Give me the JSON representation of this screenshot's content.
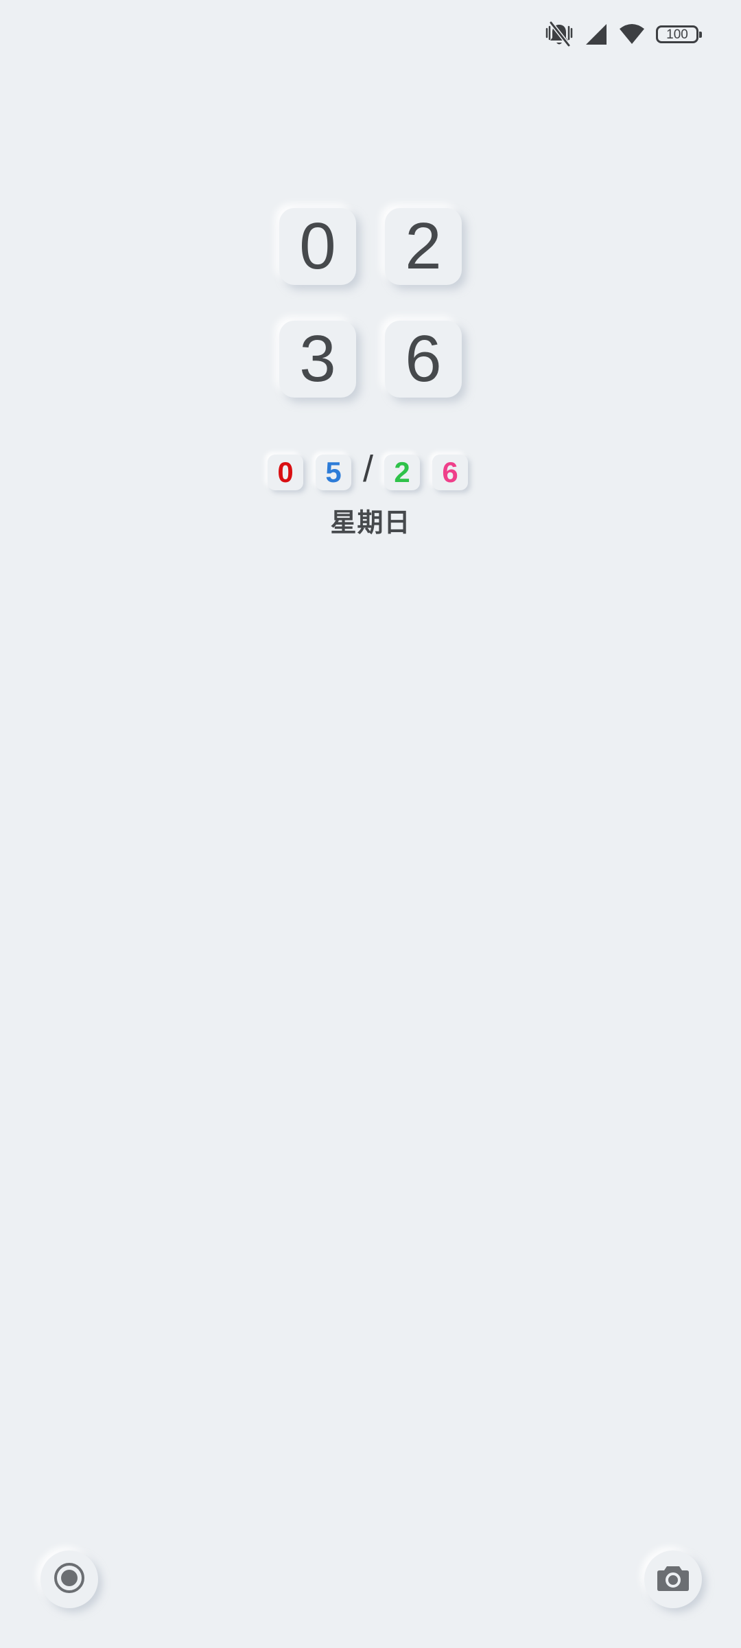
{
  "status_bar": {
    "icons": [
      "vibrate-silent-icon",
      "cellular-signal-icon",
      "wifi-icon",
      "battery-icon"
    ],
    "battery_level": "100"
  },
  "clock": {
    "hour_digits": [
      "0",
      "2"
    ],
    "minute_digits": [
      "3",
      "6"
    ],
    "digit_color": "#46494c"
  },
  "date": {
    "digits": [
      {
        "value": "0",
        "color": "#d90f12"
      },
      {
        "value": "5",
        "color": "#2d7cd8"
      },
      {
        "value": "2",
        "color": "#2fc24a"
      },
      {
        "value": "6",
        "color": "#ef3f8a"
      }
    ],
    "separator": "/",
    "weekday": "星期日"
  },
  "shortcuts": {
    "left": {
      "icon": "record-icon"
    },
    "right": {
      "icon": "camera-icon"
    }
  },
  "colors": {
    "background": "#edf0f3",
    "icon": "#3d3f42"
  }
}
